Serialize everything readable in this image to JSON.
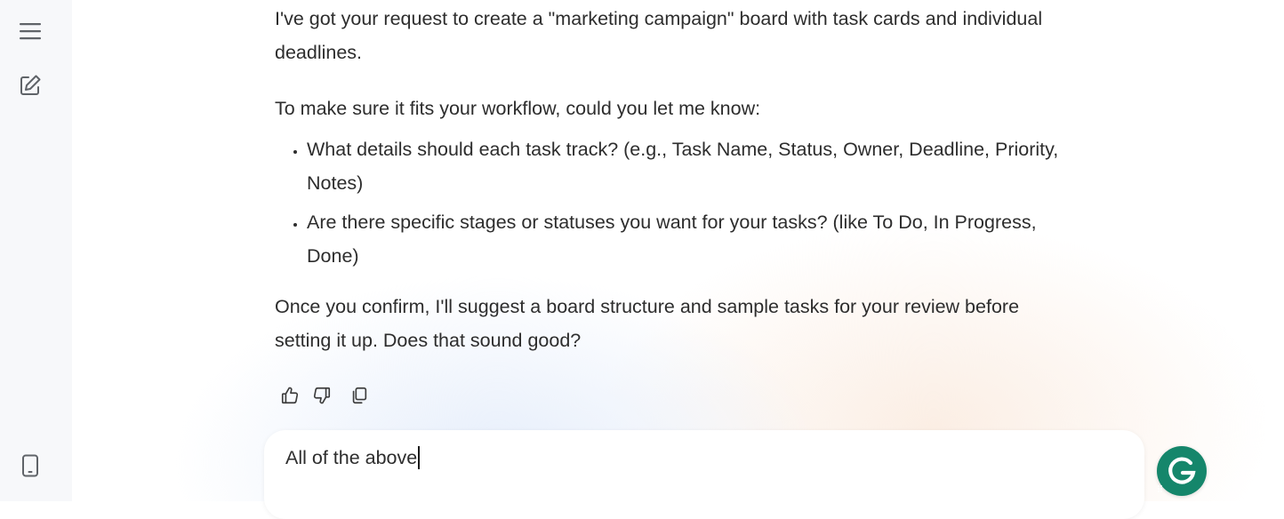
{
  "sidebar": {
    "menu_icon": "hamburger-menu-icon",
    "new_chat_icon": "edit-note-icon",
    "device_icon": "mobile-device-icon"
  },
  "message": {
    "paragraph1": "I've got your request to create a \"marketing campaign\" board with task cards and individual deadlines.",
    "paragraph2": "To make sure it fits your workflow, could you let me know:",
    "bullets": [
      "What details should each task track? (e.g., Task Name, Status, Owner, Deadline, Priority, Notes)",
      "Are there specific stages or statuses you want for your tasks? (like To Do, In Progress, Done)"
    ],
    "paragraph3": "Once you confirm, I'll suggest a board structure and sample tasks for your review before setting it up. Does that sound good?"
  },
  "actions": {
    "thumbs_up_icon": "thumbs-up-icon",
    "thumbs_down_icon": "thumbs-down-icon",
    "copy_icon": "copy-icon"
  },
  "input": {
    "value": "All of the above"
  },
  "grammarly": {
    "letter": "G",
    "color": "#15866b"
  },
  "colors": {
    "text": "#2d2d2d",
    "sidebar_bg": "#f7f8fa",
    "icon": "#5f6368"
  }
}
